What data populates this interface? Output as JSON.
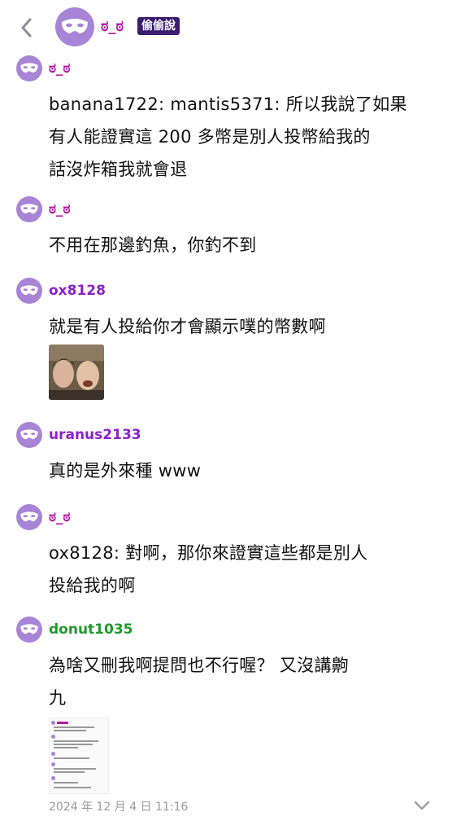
{
  "header": {
    "name": "ಠ_ಠ",
    "badge": "偷偷說"
  },
  "messages": [
    {
      "user": "ಠ_ಠ",
      "text": "banana1722: mantis5371: 所以我說了如果\n有人能證實這 200 多幣是別人投幣給我的\n話沒炸箱我就會退"
    },
    {
      "user": "ಠ_ಠ",
      "text": "不用在那邊釣魚，你釣不到"
    },
    {
      "user": "ox8128",
      "text": "就是有人投給你才會顯示噗的幣數啊"
    },
    {
      "user": "uranus2133",
      "text": "真的是外來種 www"
    },
    {
      "user": "ಠ_ಠ",
      "text": "ox8128: 對啊，那你來證實這些都是別人\n投給我的啊"
    },
    {
      "user": "donut1035",
      "text": "為啥又刪我啊提問也不行喔？ 又沒講齁\n九"
    }
  ],
  "footer": {
    "timestamp": "2024 年 12 月 4 日 11:16"
  },
  "colors": {
    "pink_user": "#b01aa0",
    "purple_user": "#8a21c9",
    "green_user": "#1f9a2d",
    "avatar": "#a784d6",
    "badge_bg": "#3a1d6e"
  },
  "icons": {
    "back": "chevron-left-icon",
    "avatar": "mask-icon",
    "expand": "chevron-down-icon"
  }
}
